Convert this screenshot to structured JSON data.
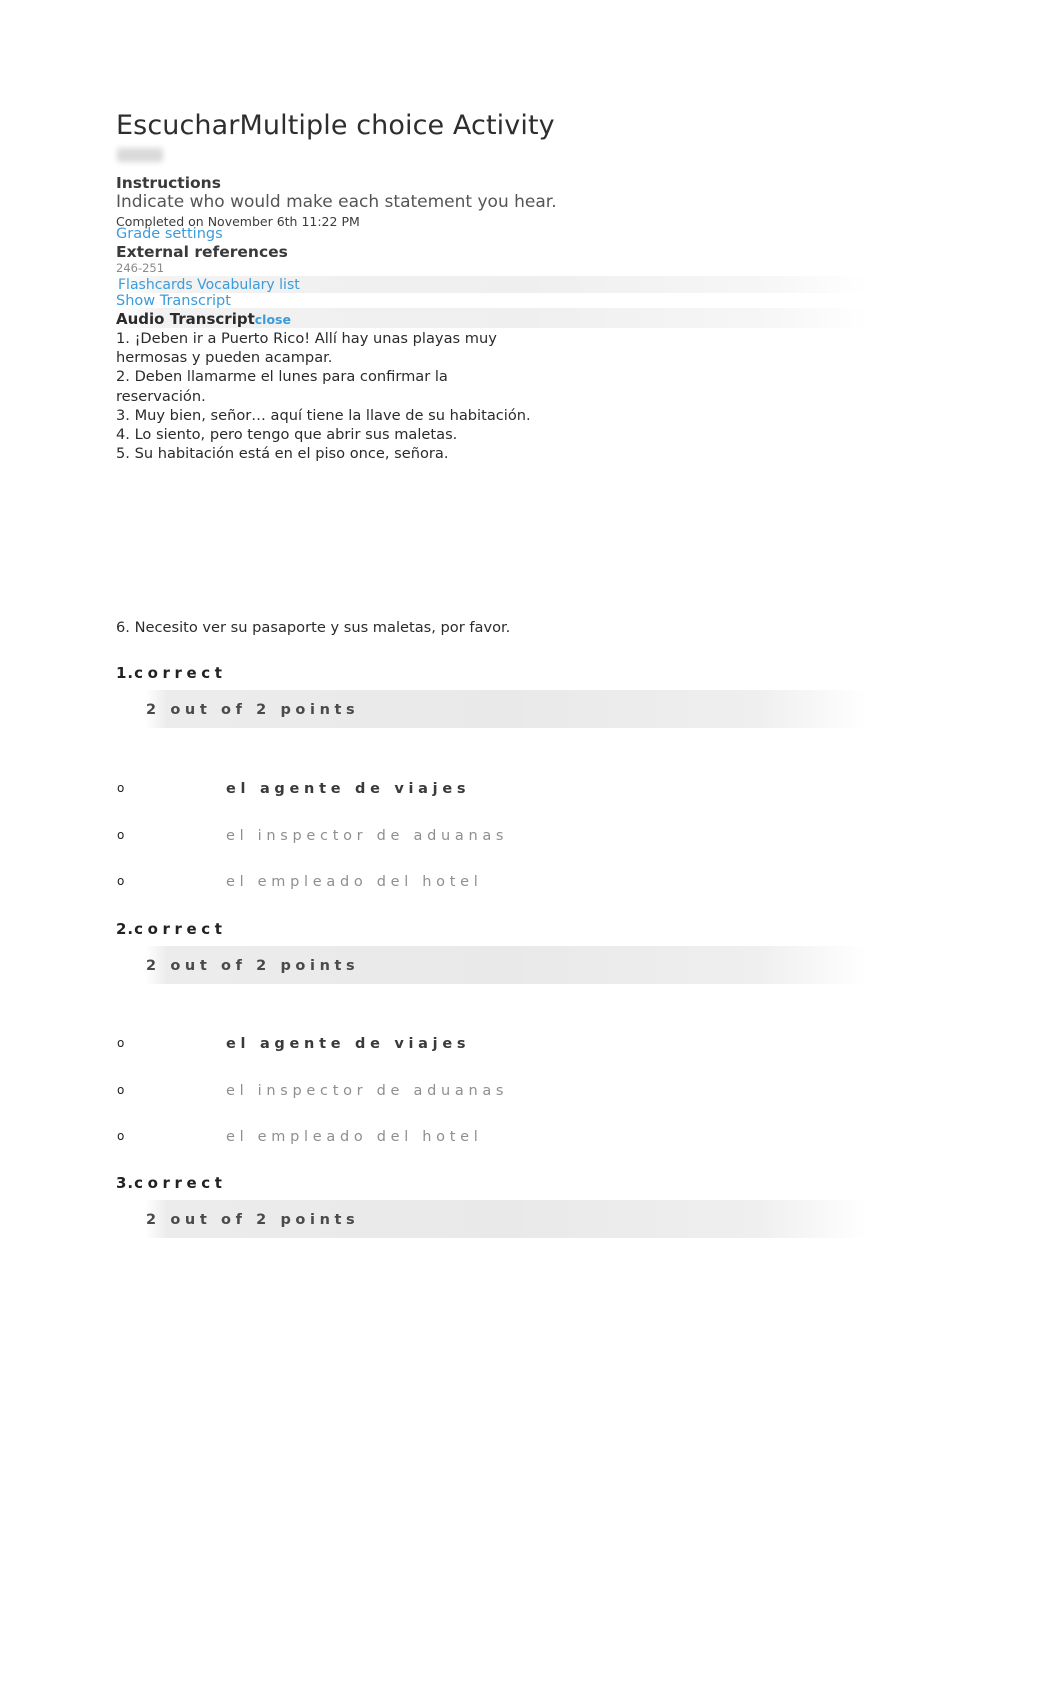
{
  "document": {
    "title": "EscucharMultiple choice Activity",
    "redacted_note": ""
  },
  "instructions": {
    "heading": "Instructions",
    "text": "Indicate who would make each statement you hear.",
    "completed_on": "Completed on November 6th 11:22 PM",
    "grade_settings_link": "Grade settings"
  },
  "external_references": {
    "heading": "External references",
    "pages": "246-251",
    "links": [
      {
        "label": "Flashcards"
      },
      {
        "label": "Vocabulary list"
      }
    ]
  },
  "transcript": {
    "show_link": "Show Transcript",
    "heading": "Audio Transcript",
    "close_label": "close",
    "lines": [
      "1. ¡Deben ir a Puerto Rico! Allí hay unas playas muy hermosas y pueden acampar.",
      "2. Deben llamarme el lunes para confirmar la reservación.",
      "3. Muy bien, señor… aquí tiene la llave de su habitación.",
      "4. Lo siento, pero tengo que abrir sus maletas.",
      "5. Su habitación está en el piso once, señora."
    ],
    "trailing_line": "6. Necesito ver su pasaporte y sus maletas, por favor."
  },
  "questions": [
    {
      "number": "1.",
      "status": "correct",
      "points": "2 out of 2 points",
      "options": [
        {
          "label": "el agente de viajes",
          "selected": true
        },
        {
          "label": "el inspector de aduanas",
          "selected": false
        },
        {
          "label": "el empleado del hotel",
          "selected": false
        }
      ]
    },
    {
      "number": "2.",
      "status": "correct",
      "points": "2 out of 2 points",
      "options": [
        {
          "label": "el agente de viajes",
          "selected": true
        },
        {
          "label": "el inspector de aduanas",
          "selected": false
        },
        {
          "label": "el empleado del hotel",
          "selected": false
        }
      ]
    },
    {
      "number": "3.",
      "status": "correct",
      "points": "2 out of 2 points",
      "options": []
    }
  ],
  "icons": {
    "radio_bullet": "o"
  },
  "colors": {
    "link": "#3b9bdc",
    "text": "#2b2b2b",
    "muted": "#8f8f8f",
    "band": "#ececec"
  }
}
